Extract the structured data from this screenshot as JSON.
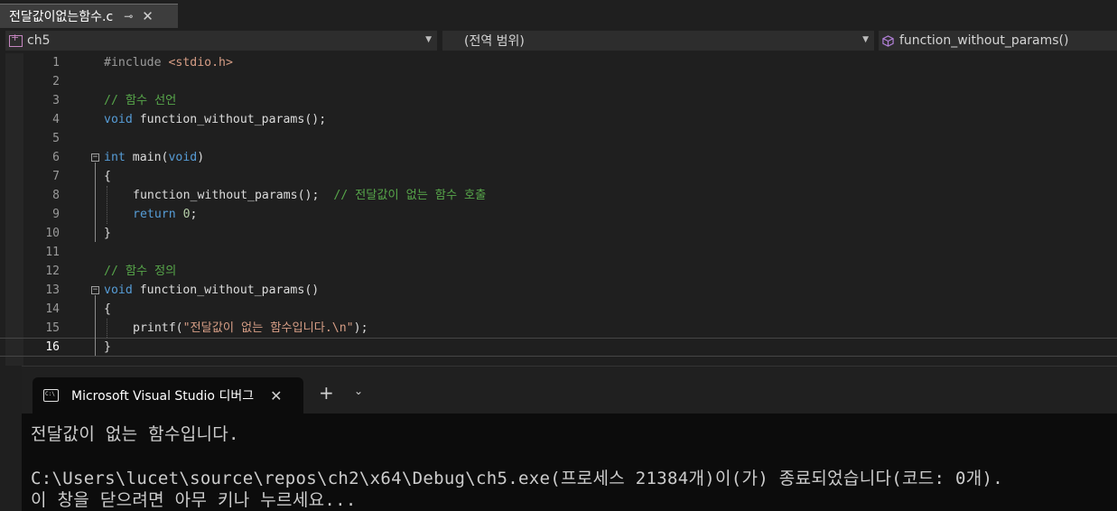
{
  "tab": {
    "filename": "전달값이없는함수.c",
    "pin_glyph": "⊸",
    "close_glyph": "✕"
  },
  "navbar": {
    "project": "ch5",
    "scope": "(전역 범위)",
    "member": "function_without_params()"
  },
  "editor": {
    "current_line": 16,
    "line_numbers": [
      "1",
      "2",
      "3",
      "4",
      "5",
      "6",
      "7",
      "8",
      "9",
      "10",
      "11",
      "12",
      "13",
      "14",
      "15",
      "16"
    ],
    "code": {
      "l1_include": "#include ",
      "l1_header": "<stdio.h>",
      "l3_comment": "// 함수 선언",
      "l4_void": "void",
      "l4_rest": " function_without_params();",
      "l6_int": "int",
      "l6_main": " main(",
      "l6_void": "void",
      "l6_close": ")",
      "l7_brace": "{",
      "l8_call": "function_without_params();",
      "l8_comment": "  // 전달값이 없는 함수 호출",
      "l9_return": "return",
      "l9_zero": " 0",
      "l9_semi": ";",
      "l10_brace": "}",
      "l12_comment": "// 함수 정의",
      "l13_void": "void",
      "l13_rest": " function_without_params()",
      "l14_brace": "{",
      "l15_printf": "printf(",
      "l15_string": "\"전달값이 없는 함수입니다.\\n\"",
      "l15_end": ");",
      "l16_brace": "}"
    }
  },
  "terminal": {
    "tab_title": "Microsoft Visual Studio 디버그",
    "close_glyph": "✕",
    "new_tab_glyph": "+",
    "dropdown_glyph": "⌄",
    "output_line1": "전달값이 없는 함수입니다.",
    "output_line2": "C:\\Users\\lucet\\source\\repos\\ch2\\x64\\Debug\\ch5.exe(프로세스 21384개)이(가) 종료되었습니다(코드: 0개).",
    "output_line3": "이 창을 닫으려면 아무 키나 누르세요..."
  },
  "colors": {
    "keyword": "#569cd6",
    "comment": "#57a64a",
    "string": "#d69d85",
    "background": "#1f1f1f",
    "terminal_bg": "#0c0c0c"
  }
}
